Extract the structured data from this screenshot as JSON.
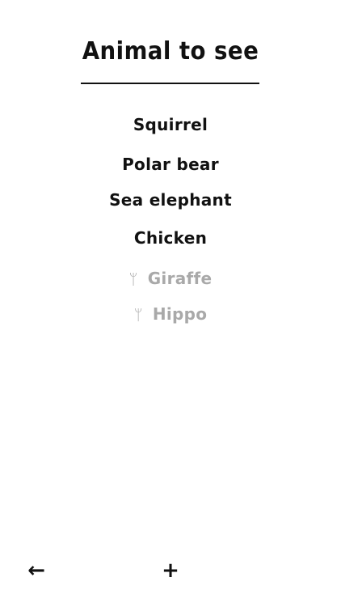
{
  "header": {
    "title": "Animal to see"
  },
  "list": {
    "items": [
      {
        "label": "Squirrel",
        "done": false
      },
      {
        "label": "Polar bear",
        "done": false
      },
      {
        "label": "Sea elephant",
        "done": false
      },
      {
        "label": "Chicken",
        "done": false
      },
      {
        "label": "Giraffe",
        "done": true,
        "check_glyph": "ᛘ"
      },
      {
        "label": "Hippo",
        "done": true,
        "check_glyph": "ᛘ"
      }
    ]
  },
  "footer": {
    "back_glyph": "←",
    "back_icon": "arrow-left-icon",
    "add_glyph": "+",
    "add_icon": "plus-icon"
  },
  "colors": {
    "text": "#111111",
    "done_text": "#a9a9a9",
    "background": "#ffffff"
  }
}
